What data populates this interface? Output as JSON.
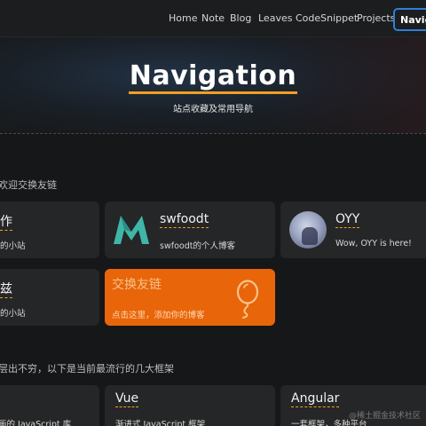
{
  "nav": {
    "items": [
      "Home",
      "Note",
      "Blog",
      "Leaves",
      "CodeSnippet",
      "Projects"
    ],
    "active": "Navigation"
  },
  "hero": {
    "title": "Navigation",
    "subtitle": "站点收藏及常用导航"
  },
  "friends": {
    "section_title": "欢迎交换友链",
    "cards": [
      {
        "name": "作",
        "desc": "的小站"
      },
      {
        "name": "swfoodt",
        "desc": "swfoodt的个人博客"
      },
      {
        "name": "OYY",
        "desc": "Wow, OYY is here!"
      },
      {
        "name": "兹",
        "desc": "的小站"
      },
      {
        "name": "交换友链",
        "desc": "点击这里，添加你的博客"
      }
    ]
  },
  "frameworks": {
    "section_title": "层出不穷，以下是当前最流行的几大框架",
    "cards": [
      {
        "name": "",
        "desc": "画的 JavaScript 库"
      },
      {
        "name": "Vue",
        "desc": "渐进式 JavaScript 框架"
      },
      {
        "name": "Angular",
        "desc": "一套框架，多种平台"
      }
    ]
  },
  "watermark": "@稀土掘金技术社区",
  "colors": {
    "accent": "#f0a020",
    "active_border": "#2f7fd6",
    "orange_card": "#e8650a",
    "swfoodt_logo": "#3fb6a8"
  },
  "icons": {
    "swfoodt_logo": "m-logo-icon",
    "oyy_avatar": "avatar-image",
    "exchange": "balloon-icon"
  }
}
